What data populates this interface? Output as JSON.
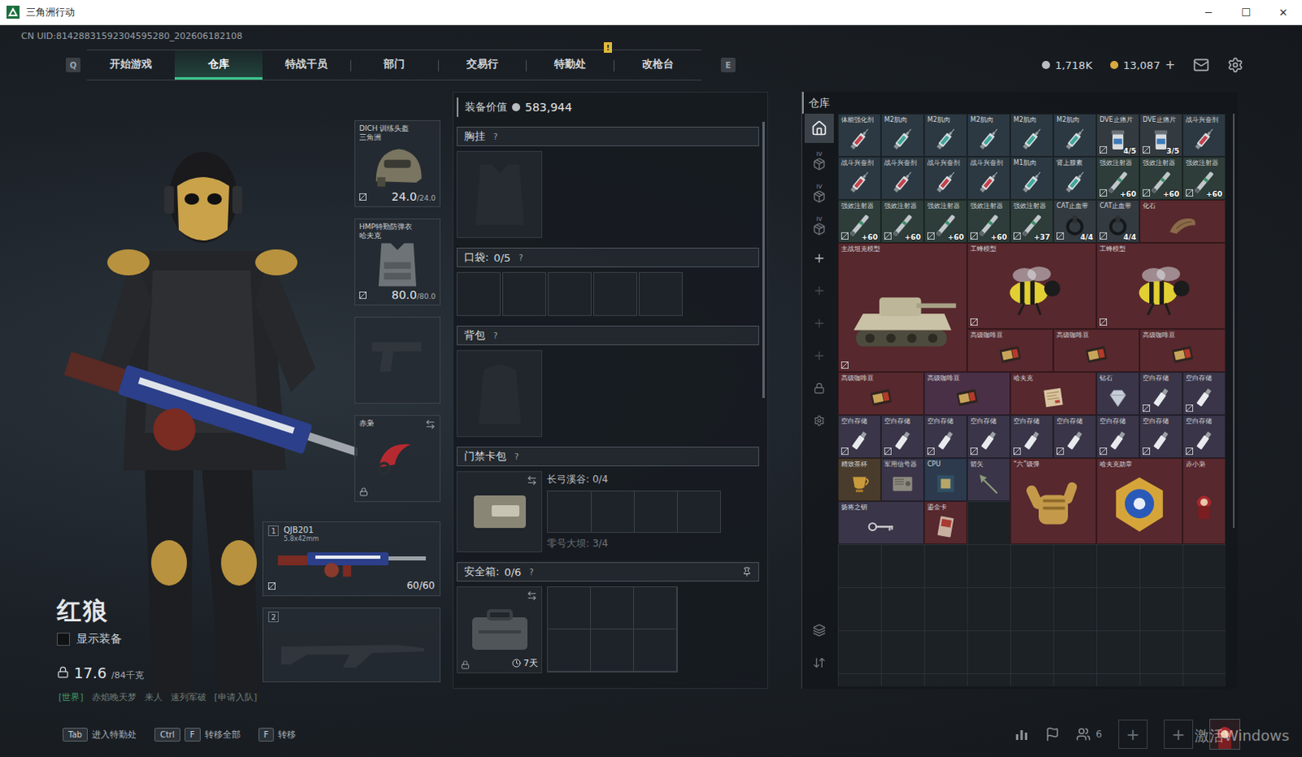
{
  "window": {
    "title": "三角洲行动",
    "controls": [
      "─",
      "☐",
      "✕"
    ]
  },
  "uid": "CN UID:81428831592304595280_202606182108",
  "nav": {
    "left_key": "Q",
    "right_key": "E",
    "tabs": [
      {
        "label": "开始游戏",
        "selected": false
      },
      {
        "label": "仓库",
        "selected": true
      },
      {
        "label": "特战干员",
        "selected": false
      },
      {
        "label": "部门",
        "selected": false
      },
      {
        "label": "交易行",
        "selected": false
      },
      {
        "label": "特勤处",
        "selected": false,
        "alert": "!"
      },
      {
        "label": "改枪台",
        "selected": false
      }
    ],
    "currencies": [
      {
        "value": "1,718K",
        "color": "#b9bec3"
      },
      {
        "value": "13,087",
        "color": "#d9a93c",
        "action": "+"
      }
    ]
  },
  "operator": {
    "name": "红狼",
    "show_equipment": {
      "label": "显示装备",
      "checked": false
    },
    "weight": {
      "value": "17.6",
      "max": "/84千克",
      "locked": true
    }
  },
  "chat": {
    "channel": "[世界]",
    "sender": "赤焰晚天梦",
    "message": "来人",
    "extra": "速列军破",
    "action": "[申请入队]"
  },
  "equipment": [
    {
      "kind": "helmet",
      "name": "DICH 训练头盔",
      "brand": "三角洲",
      "durability": "24.0",
      "max": "/24.0",
      "bound": true
    },
    {
      "kind": "armor",
      "name": "HMP特勤防弹衣",
      "brand": "哈夫克",
      "durability": "80.0",
      "max": "/80.0",
      "bound": true
    },
    {
      "kind": "pistol",
      "empty": true
    },
    {
      "kind": "melee",
      "name": "赤枭",
      "locked": true,
      "swappable": true
    }
  ],
  "weapons": [
    {
      "index": "1",
      "name": "QJB201",
      "caliber": "5.8x42mm",
      "ammo": "60/60",
      "bound": true,
      "empty": false
    },
    {
      "index": "2",
      "empty": true
    }
  ],
  "loadout": {
    "value_label": "装备价值",
    "value": "583,944",
    "help": "?",
    "chest": {
      "label": "胸挂"
    },
    "pockets": {
      "label": "口袋:",
      "count": "0/5",
      "slots": 5
    },
    "backpack": {
      "label": "背包"
    },
    "keycard": {
      "label": "门禁卡包",
      "swappable": true,
      "maps": [
        {
          "name": "长弓溪谷:",
          "count": "0/4",
          "slots": 4,
          "active": true
        },
        {
          "name": "零号大坝:",
          "count": "3/4",
          "slots": 0,
          "active": false
        }
      ]
    },
    "safe": {
      "label": "安全箱:",
      "count": "0/6",
      "duration": "7天",
      "locked": true,
      "pinned": true,
      "swappable": true,
      "slots": 6
    }
  },
  "warehouse": {
    "title": "仓库",
    "side_tabs": [
      {
        "label": "",
        "selected": true
      },
      {
        "label": "IV",
        "selected": false
      },
      {
        "label": "IV",
        "selected": false
      },
      {
        "label": "IV",
        "selected": false
      }
    ],
    "add_slots": [
      {
        "disabled": false
      },
      {
        "disabled": true
      },
      {
        "disabled": true
      },
      {
        "disabled": true
      }
    ],
    "items": [
      {
        "name": "体能强化剂",
        "color": "#2c3942",
        "bound": false
      },
      {
        "name": "M2肌肉",
        "color": "#2c3942",
        "bound": false
      },
      {
        "name": "M2肌肉",
        "color": "#2c3942",
        "bound": false
      },
      {
        "name": "M2肌肉",
        "color": "#2c3942",
        "bound": false
      },
      {
        "name": "M2肌肉",
        "color": "#2c3942",
        "bound": false
      },
      {
        "name": "M2肌肉",
        "color": "#2c3942",
        "bound": false
      },
      {
        "name": "DVE止痛片",
        "count": "4/5",
        "color": "#333a40",
        "bound": true
      },
      {
        "name": "DVE止痛片",
        "count": "3/5",
        "color": "#333a40",
        "bound": true
      },
      {
        "name": "战斗兴奋剂",
        "color": "#2c3942",
        "bound": false
      },
      {
        "name": "战斗兴奋剂",
        "color": "#2c3942",
        "bound": false
      },
      {
        "name": "战斗兴奋剂",
        "color": "#2c3942",
        "bound": false
      },
      {
        "name": "战斗兴奋剂",
        "color": "#2c3942",
        "bound": false
      },
      {
        "name": "战斗兴奋剂",
        "color": "#2c3942",
        "bound": false
      },
      {
        "name": "M1肌肉",
        "color": "#2c3942",
        "bound": false
      },
      {
        "name": "肾上腺素",
        "color": "#2c3942",
        "bound": false
      },
      {
        "name": "强效注射器",
        "count": "+60",
        "color": "#2e3d3a",
        "bound": true
      },
      {
        "name": "强效注射器",
        "count": "+60",
        "color": "#2e3d3a",
        "bound": true
      },
      {
        "name": "强效注射器",
        "count": "+60",
        "color": "#2e3d3a",
        "bound": true
      },
      {
        "name": "强效注射器",
        "count": "+60",
        "color": "#2e3d3a",
        "bound": true
      },
      {
        "name": "强效注射器",
        "count": "+60",
        "color": "#2e3d3a",
        "bound": true
      },
      {
        "name": "强效注射器",
        "count": "+60",
        "color": "#2e3d3a",
        "bound": true
      },
      {
        "name": "强效注射器",
        "count": "+60",
        "color": "#2e3d3a",
        "bound": true
      },
      {
        "name": "强效注射器",
        "count": "+37",
        "color": "#2e3d3a",
        "bound": true
      },
      {
        "name": "CAT止血带",
        "count": "4/4",
        "color": "#333a40",
        "bound": true
      },
      {
        "name": "CAT止血带",
        "count": "4/4",
        "color": "#333a40",
        "bound": true
      },
      {
        "name": "化石",
        "color": "#57282e",
        "bound": false
      },
      {
        "name": "主战坦克模型",
        "color": "#57282e",
        "bound": true
      },
      {
        "name": "工蜂模型",
        "color": "#57282e",
        "bound": true
      },
      {
        "name": "工蜂模型",
        "color": "#57282e",
        "bound": true
      },
      {
        "name": "高级咖啡豆",
        "color": "#57282e",
        "bound": false
      },
      {
        "name": "高级咖啡豆",
        "color": "#57282e",
        "bound": false
      },
      {
        "name": "高级咖啡豆",
        "color": "#57282e",
        "bound": false
      },
      {
        "name": "高级咖啡豆",
        "color": "#57282e",
        "bound": false
      },
      {
        "name": "高级咖啡豆",
        "color": "#4a3046",
        "bound": false
      },
      {
        "name": "哈夫克",
        "color": "#57282e",
        "bound": false
      },
      {
        "name": "钻石",
        "color": "#3a3548",
        "bound": false
      },
      {
        "name": "空白存储",
        "color": "#3a3548",
        "bound": true
      },
      {
        "name": "空白存储",
        "color": "#3a3548",
        "bound": true
      },
      {
        "name": "空白存储",
        "color": "#3a3548",
        "bound": true
      },
      {
        "name": "空白存储",
        "color": "#3a3548",
        "bound": true
      },
      {
        "name": "空白存储",
        "color": "#3a3548",
        "bound": true
      },
      {
        "name": "空白存储",
        "color": "#3a3548",
        "bound": true
      },
      {
        "name": "空白存储",
        "color": "#3a3548",
        "bound": true
      },
      {
        "name": "空白存储",
        "color": "#3a3548",
        "bound": true
      },
      {
        "name": "空白存储",
        "color": "#3a3548",
        "bound": true
      },
      {
        "name": "空白存储",
        "color": "#3a3548",
        "bound": true
      },
      {
        "name": "空白存储",
        "color": "#3a3548",
        "bound": true
      },
      {
        "name": "精致茶杯",
        "color": "#4a3c2c",
        "bound": false
      },
      {
        "name": "军用信号器",
        "color": "#3a3548",
        "bound": false
      },
      {
        "name": "CPU",
        "color": "#2d3a4e",
        "bound": false
      },
      {
        "name": "箭矢",
        "color": "#3a3548",
        "bound": false
      },
      {
        "name": "“六”级弹",
        "color": "#57282e",
        "bound": false
      },
      {
        "name": "哈夫克勋章",
        "color": "#57282e",
        "bound": false
      },
      {
        "name": "赤小枭",
        "color": "#57282e",
        "bound": false
      },
      {
        "name": "扬将之钥",
        "color": "#3a3548",
        "bound": false
      },
      {
        "name": "鎏金卡",
        "color": "#57282e",
        "bound": false
      }
    ]
  },
  "hints": [
    {
      "keys": [
        "Tab"
      ],
      "label": "进入特勤处"
    },
    {
      "keys": [
        "Ctrl",
        "F"
      ],
      "label": "转移全部"
    },
    {
      "keys": [
        "F"
      ],
      "label": "转移"
    }
  ],
  "social": {
    "friends": "6",
    "slots": [
      "+",
      "+"
    ]
  },
  "watermark": "激活Windows"
}
